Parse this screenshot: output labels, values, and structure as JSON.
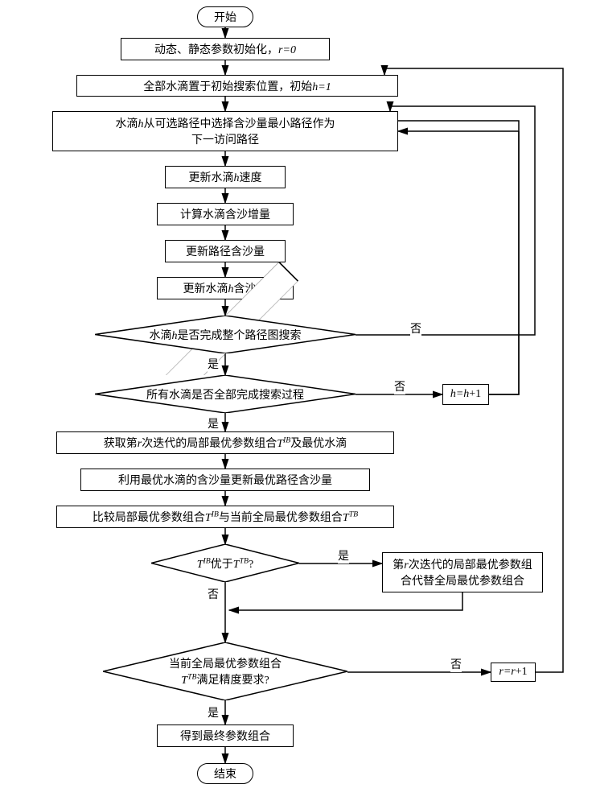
{
  "flowchart": {
    "start": "开始",
    "end": "结束",
    "steps": {
      "init": "动态、静态参数初始化，",
      "init_r": "r=0",
      "place": "全部水滴置于初始搜索位置，初始",
      "place_h": "h=1",
      "select_path_l1": "水滴",
      "select_path_h": "h",
      "select_path_l2": "从可选路径中选择含沙量最小路径作为",
      "select_path_l3": "下一访问路径",
      "update_speed_l": "更新水滴",
      "update_speed_h": "h",
      "update_speed_r": "速度",
      "calc_sand": "计算水滴含沙增量",
      "update_path_sand": "更新路径含沙量",
      "update_drop_sand_l": "更新水滴",
      "update_drop_sand_h": "h",
      "update_drop_sand_r": "含沙量",
      "decision_path_l": "水滴",
      "decision_path_h": "h",
      "decision_path_r": "是否完成整个路径图搜索",
      "decision_all": "所有水滴是否全部完成搜索过程",
      "get_local_l": "获取第",
      "get_local_r": "r",
      "get_local_m": "次迭代的局部最优参数组合",
      "get_local_tib": "T",
      "get_local_ibsup": "IB",
      "get_local_e": "及最优水滴",
      "update_best_path": "利用最优水滴的含沙量更新最优路径含沙量",
      "compare_l": "比较局部最优参数组合",
      "compare_tib": "T",
      "compare_ibsup": "IB",
      "compare_m": "与当前全局最优参数组合",
      "compare_ttb": "T",
      "compare_tbsup": "TB",
      "decision_better_tib": "T",
      "decision_better_ibsup": "IB",
      "decision_better_m": "优于",
      "decision_better_ttb": "T",
      "decision_better_tbsup": "TB",
      "decision_better_q": "?",
      "replace_l1": "第",
      "replace_r": "r",
      "replace_l2": "次迭代的局部最优参数组",
      "replace_l3": "合代替全局最优参数组合",
      "decision_precision_l1": "当前全局最优参数组合",
      "decision_precision_ttb": "T",
      "decision_precision_tbsup": "TB",
      "decision_precision_l2": "满足精度要求?",
      "final": "得到最终参数组合",
      "inc_h_l": "h=h",
      "inc_h_r": "+1",
      "inc_r_l": "r=r",
      "inc_r_r": "+1"
    },
    "labels": {
      "yes": "是",
      "no": "否"
    }
  }
}
